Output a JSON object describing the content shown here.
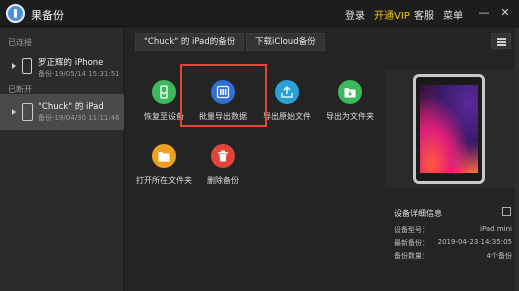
{
  "window": {
    "title": "果备份",
    "nav": [
      "登录",
      "开通VIP",
      "客服",
      "菜单"
    ],
    "controls": [
      "—",
      "✕"
    ]
  },
  "sidebar": {
    "connected_label": "已连接",
    "disconnected_label": "已断开",
    "devices": [
      {
        "name": "罗正辉的 iPhone",
        "backup": "备份-19/05/14 15:31:51",
        "active": false
      },
      {
        "name": "\"Chuck\" 的 iPad",
        "backup": "备份-19/04/30 11:11:46",
        "active": true
      }
    ]
  },
  "main": {
    "tabs": [
      "\"Chuck\" 的 iPad的备份",
      "下载iCloud备份"
    ],
    "actions": [
      {
        "label": "恢复至设备",
        "color": "#3cb95a",
        "icon": "restore-icon"
      },
      {
        "label": "批量导出数据",
        "color": "#2f6fd6",
        "icon": "batch-export-icon"
      },
      {
        "label": "导出原始文件",
        "color": "#2aa0d8",
        "icon": "export-raw-icon"
      },
      {
        "label": "导出为文件夹",
        "color": "#3cb95a",
        "icon": "export-folder-icon"
      },
      {
        "label": "打开所在文件夹",
        "color": "#f0a020",
        "icon": "open-folder-icon"
      },
      {
        "label": "删除备份",
        "color": "#e0443a",
        "icon": "trash-icon"
      }
    ]
  },
  "device_info": {
    "title": "设备详细信息",
    "rows": [
      {
        "key": "设备型号：",
        "value": "iPad mini"
      },
      {
        "key": "最新备份：",
        "value": "2019-04-23 14:35:05"
      },
      {
        "key": "备份数量：",
        "value": "4个备份"
      }
    ]
  }
}
